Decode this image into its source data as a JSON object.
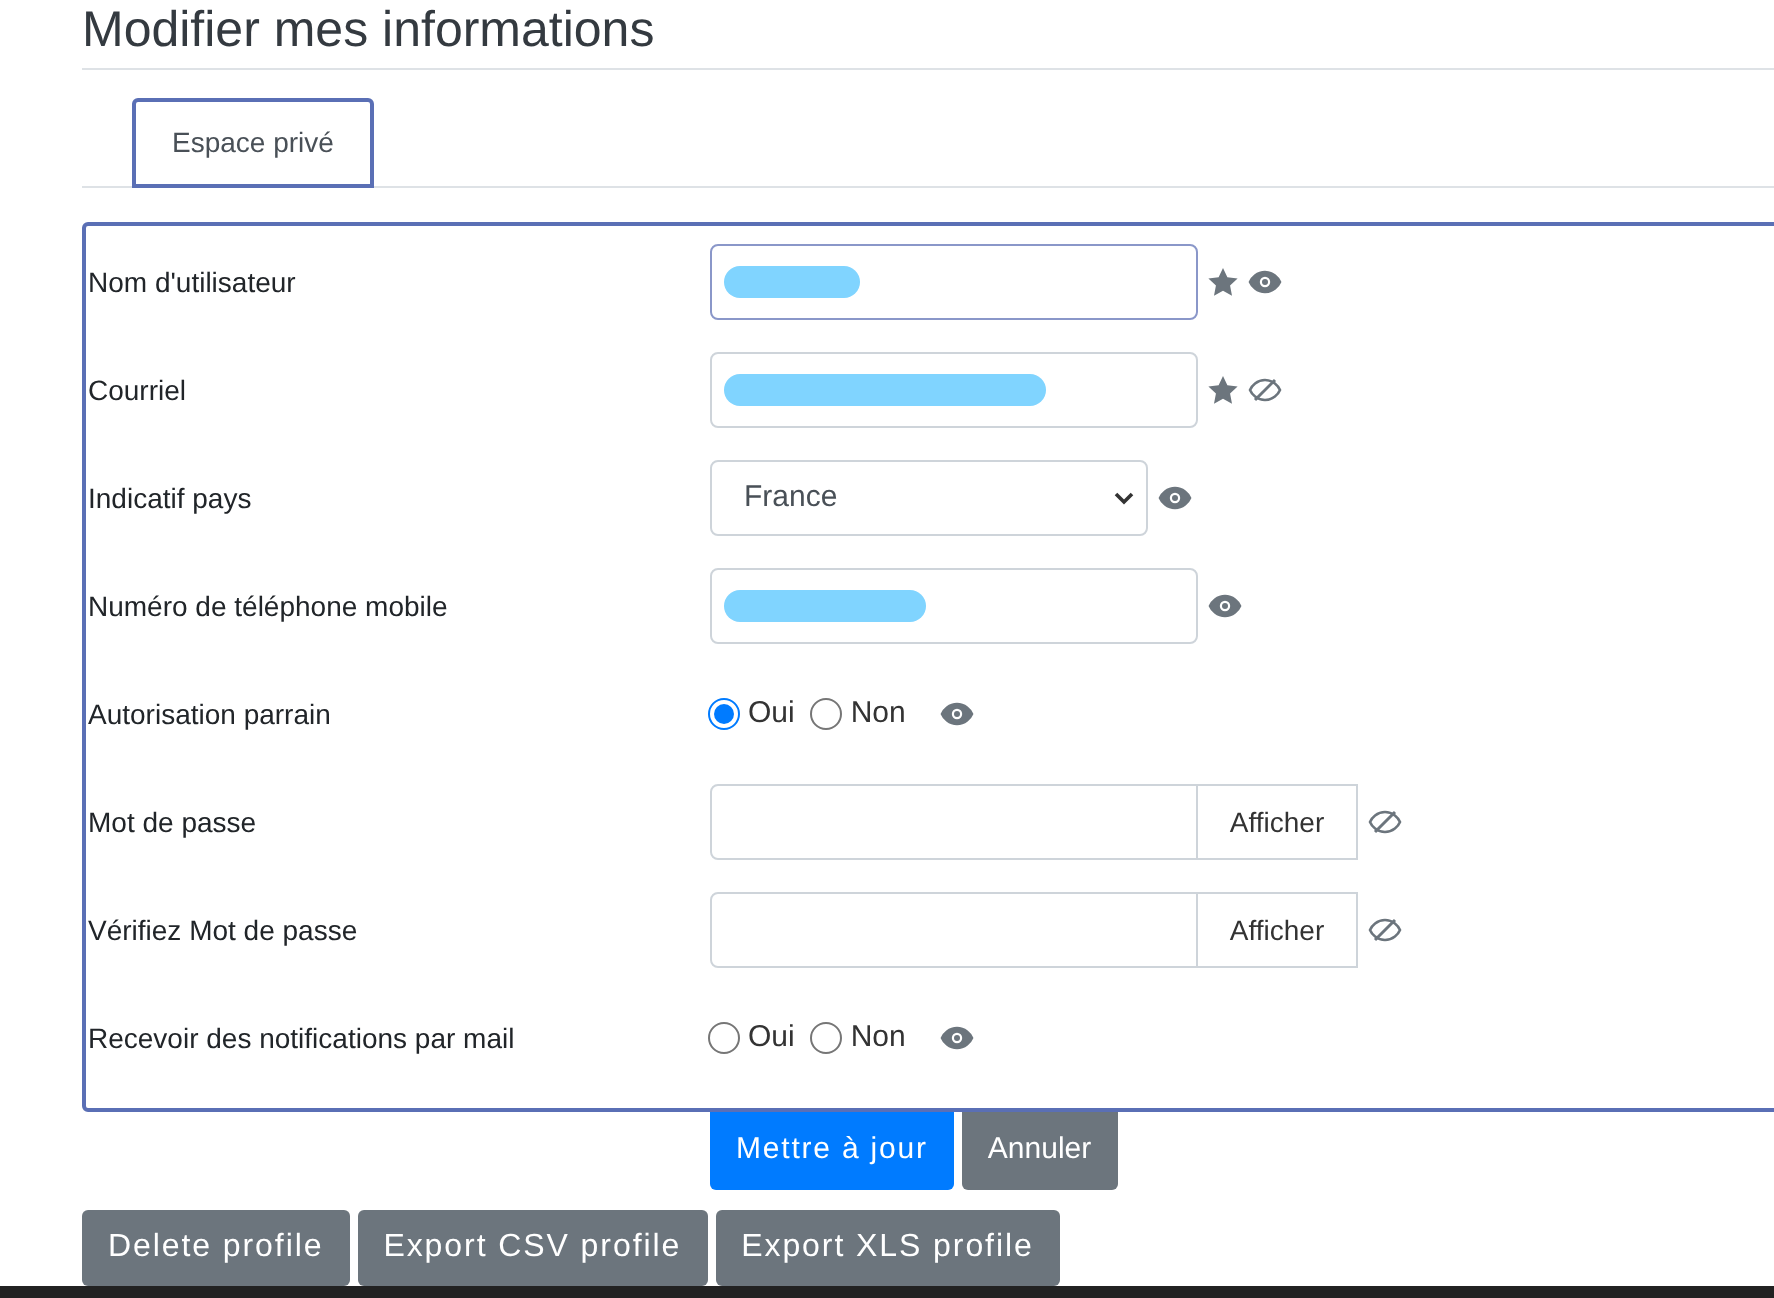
{
  "page_title": "Modifier mes informations",
  "tabs": [
    {
      "label": "Espace privé",
      "selected": true
    }
  ],
  "fields": [
    {
      "kind": "text",
      "label": "Nom d'utilisateur",
      "redacted": true,
      "required": true,
      "visible": true
    },
    {
      "kind": "text",
      "label": "Courriel",
      "redacted": true,
      "required": true,
      "visible": false
    },
    {
      "kind": "select",
      "label": "Indicatif pays",
      "value": "France",
      "required": false,
      "visible": true
    },
    {
      "kind": "text",
      "label": "Numéro de téléphone mobile",
      "redacted": true,
      "required": false,
      "visible": true
    },
    {
      "kind": "radio",
      "label": "Autorisation parrain",
      "options": [
        {
          "label": "Oui",
          "selected": true
        },
        {
          "label": "Non",
          "selected": false
        }
      ],
      "required": false,
      "visible": true
    },
    {
      "kind": "password",
      "label": "Mot de passe",
      "button": "Afficher",
      "required": false,
      "visible": false
    },
    {
      "kind": "password",
      "label": "Vérifiez Mot de passe",
      "button": "Afficher",
      "required": false,
      "visible": false
    },
    {
      "kind": "radio",
      "label": "Recevoir des notifications par mail",
      "options": [
        {
          "label": "Oui",
          "selected": false
        },
        {
          "label": "Non",
          "selected": false
        }
      ],
      "required": false,
      "visible": true
    }
  ],
  "form_buttons": [
    {
      "label": "Mettre à jour",
      "kind": "primary"
    },
    {
      "label": "Annuler",
      "kind": "secondary"
    }
  ],
  "profile_buttons": [
    "Delete profile",
    "Export CSV profile",
    "Export XLS profile"
  ]
}
